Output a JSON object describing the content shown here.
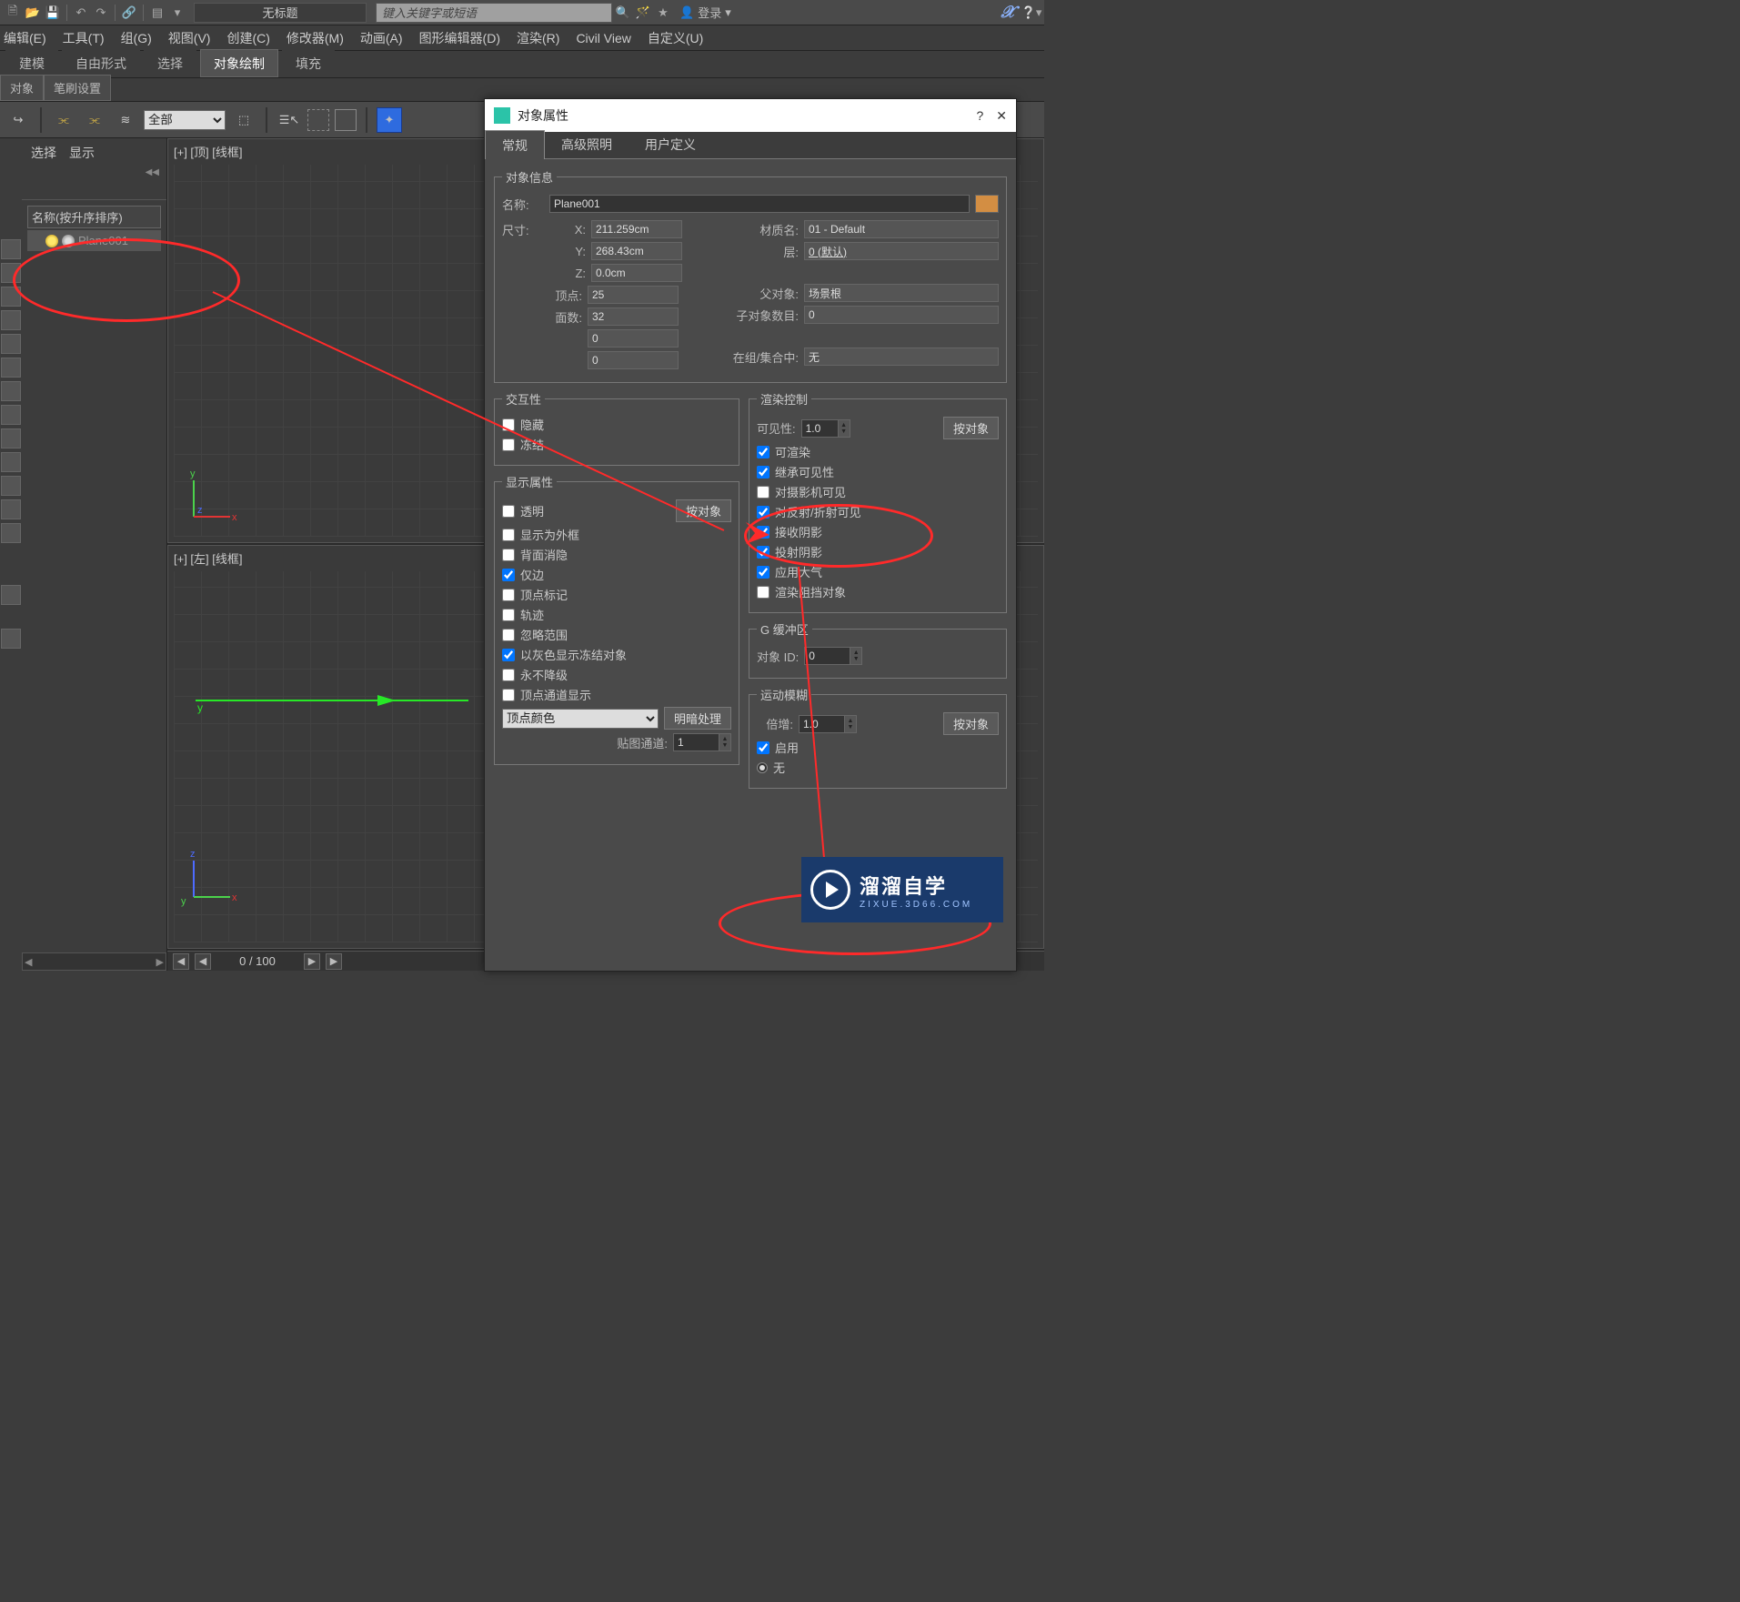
{
  "top": {
    "title": "无标题",
    "search_placeholder": "键入关键字或短语",
    "login": "登录"
  },
  "menu": [
    "编辑(E)",
    "工具(T)",
    "组(G)",
    "视图(V)",
    "创建(C)",
    "修改器(M)",
    "动画(A)",
    "图形编辑器(D)",
    "渲染(R)",
    "Civil View",
    "自定义(U)"
  ],
  "ribbon_tabs": [
    "建模",
    "自由形式",
    "选择",
    "对象绘制",
    "填充"
  ],
  "ribbon_active": "对象绘制",
  "sub_tabs": [
    "对象",
    "笔刷设置"
  ],
  "toolbar3": {
    "dropdown": "全部"
  },
  "outline": {
    "head": [
      "选择",
      "显示"
    ],
    "caption": "名称(按升序排序)",
    "item": "Plane001"
  },
  "viewports": {
    "top": "[+] [顶] [线框]",
    "left": "[+] [左] [线框]",
    "timeline": "0 / 100"
  },
  "dialog": {
    "title": "对象属性",
    "tabs": [
      "常规",
      "高级照明",
      "用户定义"
    ],
    "active_tab": "常规",
    "info": {
      "legend": "对象信息",
      "name_label": "名称:",
      "name": "Plane001",
      "dim_label": "尺寸:",
      "x_label": "X:",
      "x": "211.259cm",
      "y_label": "Y:",
      "y": "268.43cm",
      "z_label": "Z:",
      "z": "0.0cm",
      "verts_label": "顶点:",
      "verts": "25",
      "faces_label": "面数:",
      "faces": "32",
      "extra1": "0",
      "extra2": "0",
      "mat_label": "材质名:",
      "mat": "01 - Default",
      "layer_label": "层:",
      "layer": "0 (默认)",
      "parent_label": "父对象:",
      "parent": "场景根",
      "children_label": "子对象数目:",
      "children": "0",
      "group_label": "在组/集合中:",
      "group": "无"
    },
    "interact": {
      "legend": "交互性",
      "hide": "隐藏",
      "freeze": "冻结"
    },
    "display": {
      "legend": "显示属性",
      "byobj": "按对象",
      "transparent": "透明",
      "as_box": "显示为外框",
      "backface": "背面消隐",
      "edges_only": "仅边",
      "vertex_ticks": "顶点标记",
      "trajectory": "轨迹",
      "ignore_extents": "忽略范围",
      "show_frozen_gray": "以灰色显示冻结对象",
      "never_degrade": "永不降级",
      "vc_display": "顶点通道显示",
      "vc_dropdown": "顶点颜色",
      "shading": "明暗处理",
      "map_channel_label": "贴图通道:",
      "map_channel": "1"
    },
    "render": {
      "legend": "渲染控制",
      "visibility_label": "可见性:",
      "visibility": "1.0",
      "byobj": "按对象",
      "renderable": "可渲染",
      "inherit_vis": "继承可见性",
      "visible_to_cam": "对摄影机可见",
      "visible_refl": "对反射/折射可见",
      "receive_shadows": "接收阴影",
      "cast_shadows": "投射阴影",
      "apply_atmos": "应用大气",
      "render_occluded": "渲染阻挡对象"
    },
    "gbuffer": {
      "legend": "G 缓冲区",
      "objid_label": "对象 ID:",
      "objid": "0"
    },
    "mblur": {
      "legend": "运动模糊",
      "mult_label": "倍增:",
      "mult": "1.0",
      "byobj": "按对象",
      "enable": "启用",
      "none": "无"
    }
  },
  "watermark": {
    "big": "溜溜自学",
    "small": "ZIXUE.3D66.COM"
  }
}
